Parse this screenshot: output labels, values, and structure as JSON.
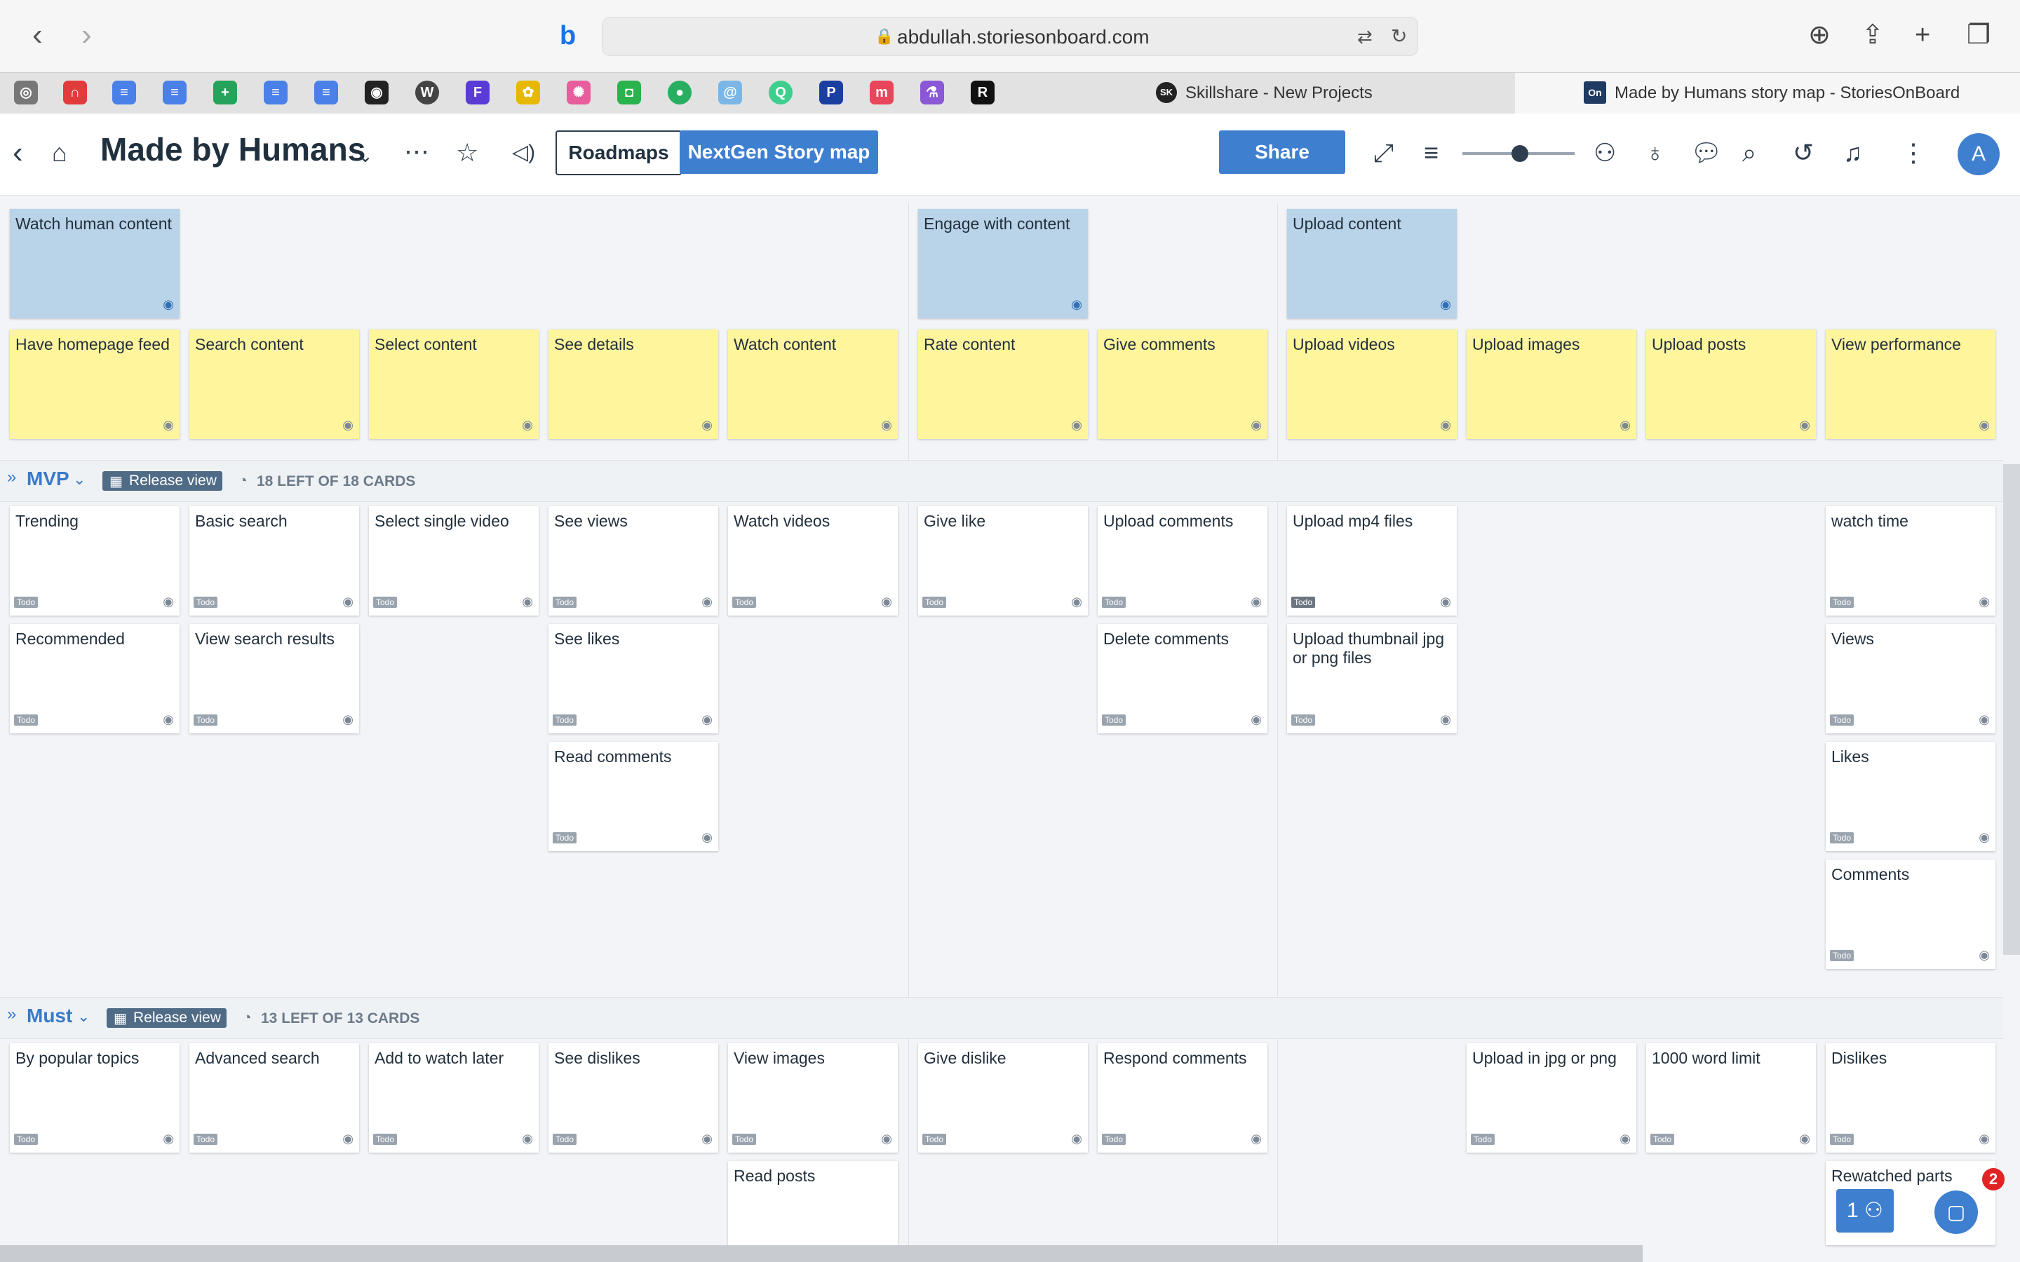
{
  "browser": {
    "url": "abdullah.storiesonboard.com",
    "tabs": [
      {
        "label": "Skillshare - New Projects",
        "favicon": "SK"
      },
      {
        "label": "Made by Humans story map - StoriesOnBoard",
        "favicon": "On"
      }
    ]
  },
  "header": {
    "title": "Made by Humans",
    "roadmaps_label": "Roadmaps",
    "nextgen_label": "NextGen Story map",
    "share_label": "Share",
    "avatar_initial": "A",
    "accent": "#3f7fd0"
  },
  "activities": [
    "Watch human content",
    "Engage with content",
    "Upload content"
  ],
  "steps": [
    "Have homepage feed",
    "Search content",
    "Select content",
    "See details",
    "Watch content",
    "Rate content",
    "Give comments",
    "Upload videos",
    "Upload images",
    "Upload posts",
    "View performance"
  ],
  "releases": [
    {
      "name": "MVP",
      "view_label": "Release view",
      "count_text": "18 LEFT OF 18 CARDS"
    },
    {
      "name": "Must",
      "view_label": "Release view",
      "count_text": "13 LEFT OF 13 CARDS"
    }
  ],
  "mvp_cards": [
    "Trending",
    "Recommended",
    "Basic search",
    "View search results",
    "Select single video",
    "See views",
    "See likes",
    "Read comments",
    "Watch videos",
    "Give like",
    "Upload comments",
    "Delete comments",
    "Upload mp4 files",
    "Upload thumbnail jpg or png files",
    "watch time",
    "Views",
    "Likes",
    "Comments"
  ],
  "must_cards": [
    "By popular topics",
    "Advanced search",
    "Add to watch later",
    "See dislikes",
    "View images",
    "Read posts",
    "Give dislike",
    "Respond comments",
    "Upload in jpg or png",
    "1000 word limit",
    "Dislikes",
    "Rewatched parts"
  ],
  "card_status": "Todo",
  "widgets": {
    "notification_count": "2",
    "people_label": "1"
  }
}
